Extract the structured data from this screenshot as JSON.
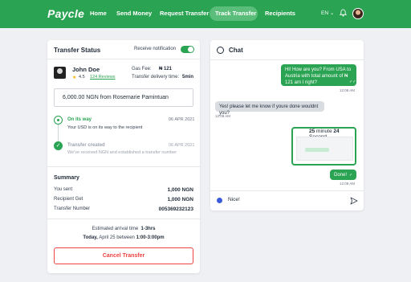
{
  "nav": {
    "brand": "Paycle",
    "links": [
      "Home",
      "Send Money",
      "Request Transfer",
      "Track Transfer",
      "Recipients"
    ],
    "active": "Track Transfer",
    "language": "EN",
    "accent": "#2aa352"
  },
  "transfer": {
    "title": "Transfer Status",
    "notification_label": "Receive notification",
    "notification_on": true,
    "recipient": {
      "name": "John Doe",
      "rating": "4.5",
      "reviews": "124 Reviews"
    },
    "gas_fee_label": "Gas Fee:",
    "gas_fee_value": "₦ 121",
    "delivery_label": "Transfer delivery time:",
    "delivery_value": "5min",
    "amount_line": "6,000.00 NGN from Rosemarie Pamintuan",
    "timeline": [
      {
        "title": "On its way",
        "date": "06 APR 2021",
        "desc": "Your USD is on its way to the recipient"
      },
      {
        "title": "Transfer created",
        "date": "06 APR 2021",
        "desc": "We've received NGN and established a transfer number"
      }
    ],
    "summary": {
      "heading": "Summary",
      "rows": [
        {
          "label": "You sent",
          "value": "1,000 NGN"
        },
        {
          "label": "Recipient Get",
          "value": "1,000 NGN"
        },
        {
          "label": "Transfer Number",
          "value": "005369232123"
        }
      ]
    },
    "eta_label": "Estimated arrival time",
    "eta_value": "1-3hrs",
    "today_prefix": "Today,",
    "today_value": "April 25 between",
    "today_time": "1:00-3:00pm",
    "cancel_label": "Cancel Transfer"
  },
  "chat": {
    "title": "Chat",
    "messages": [
      {
        "from": "me",
        "text": "Hi! How are you? From USA to Austria with total amount of ₦ 121 am I right?",
        "time": "12:08 AM"
      },
      {
        "from": "them",
        "text": "Yes! please let me know if youre done wouldnt you?",
        "time": "12:08 AM"
      },
      {
        "from": "me",
        "text": "",
        "time": ""
      },
      {
        "from": "me",
        "text": "Done!",
        "time": "12:08 AM"
      }
    ],
    "screenshot_caption_num1": "25",
    "screenshot_caption_word1": "minute",
    "screenshot_caption_num2": "24",
    "screenshot_caption_word2": "Second",
    "input_value": "Nice!"
  }
}
